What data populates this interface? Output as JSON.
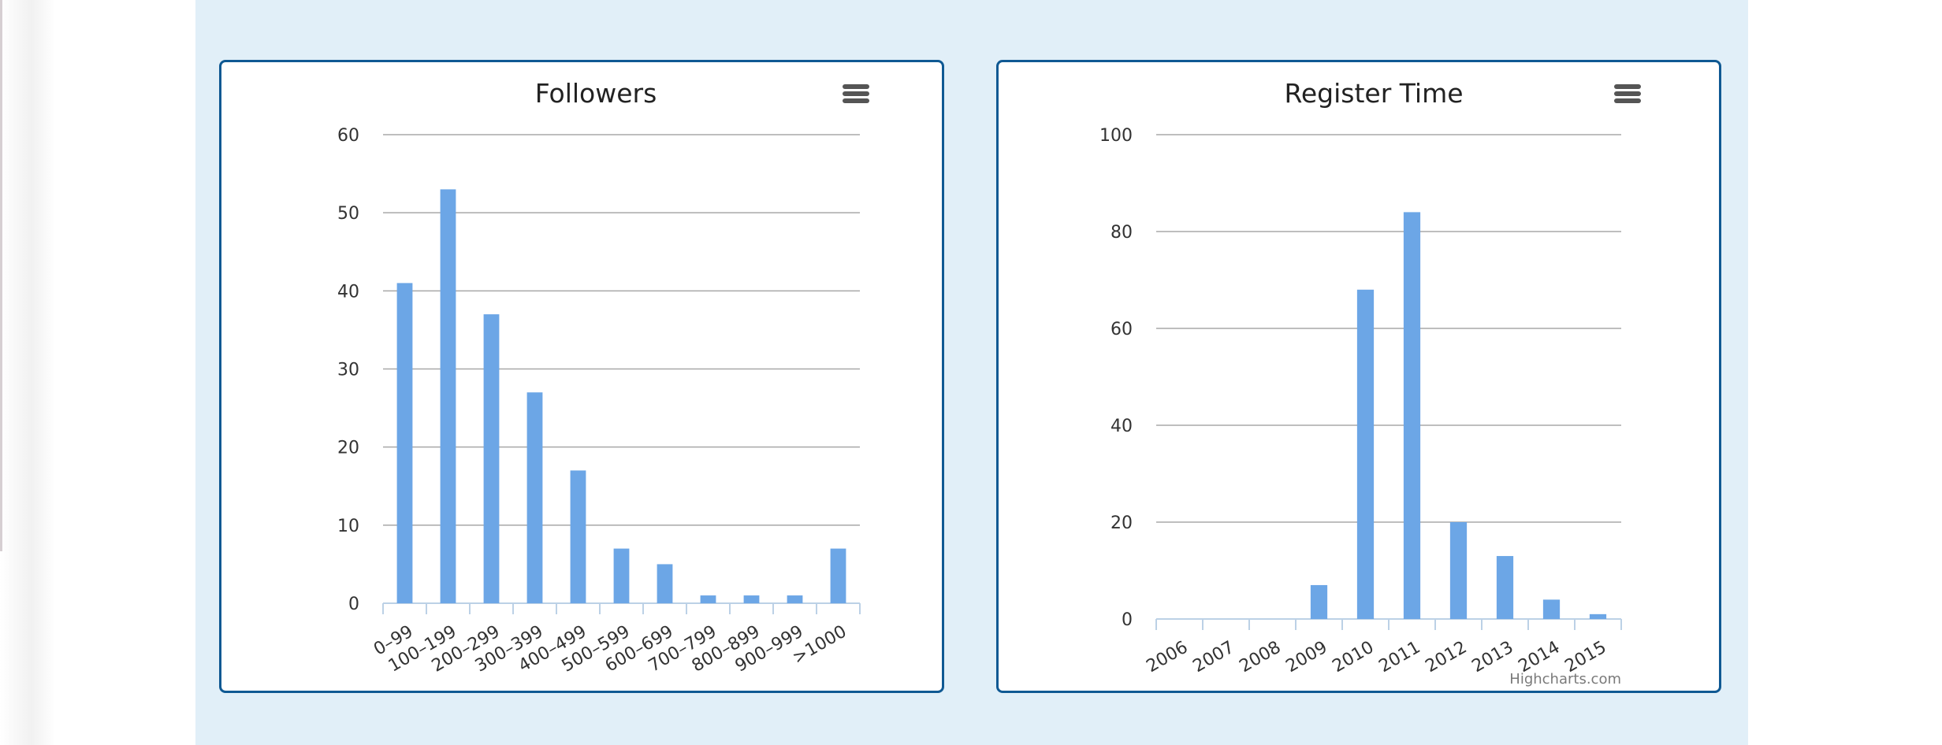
{
  "theme": {
    "background": "#e1eff8",
    "card_border": "#0f5993",
    "bar_color": "#6ca6e6",
    "grid_color": "#a8a8a8",
    "axis_color": "#bcd1e6"
  },
  "menu_icon": "hamburger-menu-icon",
  "credits": "Highcharts.com",
  "chart_data": [
    {
      "type": "bar",
      "title": "Followers",
      "categories": [
        "0–99",
        "100–199",
        "200–299",
        "300–399",
        "400–499",
        "500–599",
        "600–699",
        "700–799",
        "800–899",
        "900–999",
        ">1000"
      ],
      "values": [
        41,
        53,
        37,
        27,
        17,
        7,
        5,
        1,
        1,
        1,
        7
      ],
      "ylim": [
        0,
        60
      ],
      "yticks": [
        "0",
        "10",
        "20",
        "30",
        "40",
        "50",
        "60"
      ],
      "grid": true
    },
    {
      "type": "bar",
      "title": "Register Time",
      "categories": [
        "2006",
        "2007",
        "2008",
        "2009",
        "2010",
        "2011",
        "2012",
        "2013",
        "2014",
        "2015"
      ],
      "values": [
        0,
        0,
        0,
        7,
        68,
        84,
        20,
        13,
        4,
        1
      ],
      "ylim": [
        0,
        100
      ],
      "yticks": [
        "0",
        "20",
        "40",
        "60",
        "80",
        "100"
      ],
      "grid": true
    }
  ]
}
